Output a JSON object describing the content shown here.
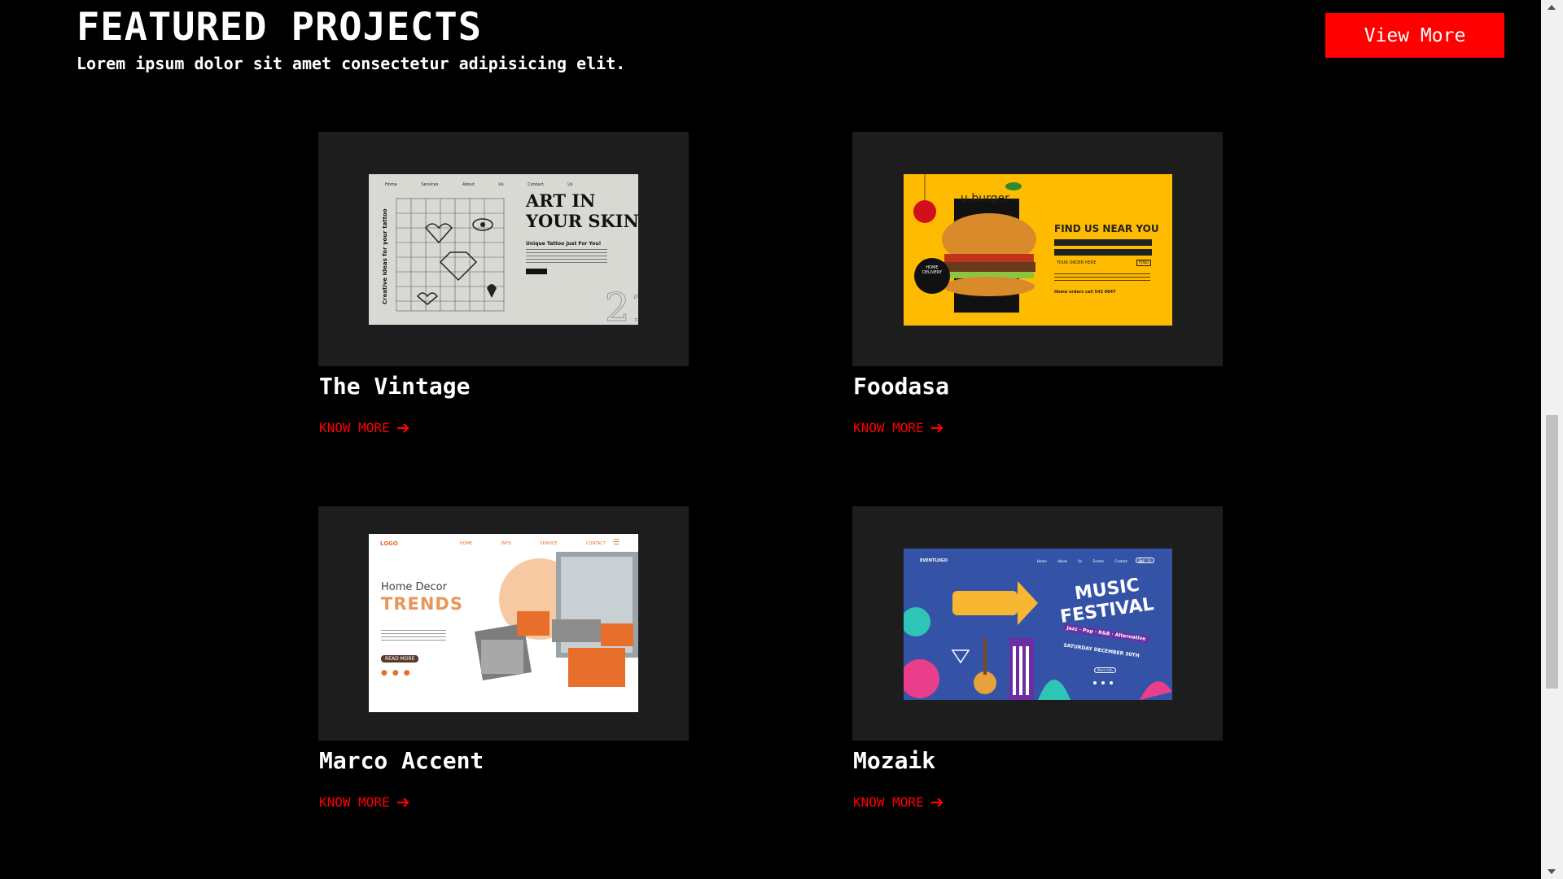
{
  "header": {
    "title": "FEATURED PROJECTS",
    "subtitle": "Lorem ipsum dolor sit amet consectetur adipisicing elit.",
    "view_more_label": "View More"
  },
  "colors": {
    "accent": "#ff0000",
    "background": "#000000",
    "card_bg": "#1d1d1d",
    "text": "#ffffff"
  },
  "projects": [
    {
      "title": "The Vintage",
      "link_label": "KNOW MORE",
      "thumbnail": {
        "headline_1": "ART IN",
        "headline_2": "YOUR SKIN",
        "tagline": "Unique Tattoo Just For You!",
        "side_text": "Creative Ideas for your tattoo",
        "nav": [
          "Home",
          "Services",
          "About Us",
          "Contact Us"
        ]
      }
    },
    {
      "title": "Foodasa",
      "link_label": "KNOW MORE",
      "thumbnail": {
        "brand": "u.burger",
        "headline": "FIND US NEAR YOU",
        "badge": "HOME DELIVERY",
        "order_label": "YOUR ORDER HERE",
        "find_button": "FIND",
        "phone": "Home orders call 543 0847"
      }
    },
    {
      "title": "Marco Accent",
      "link_label": "KNOW MORE",
      "thumbnail": {
        "logo": "LOGO",
        "nav": [
          "HOME",
          "INFO",
          "SERVICE",
          "CONTACT"
        ],
        "headline_1": "Home Decor",
        "headline_2": "TRENDS",
        "cta": "READ MORE"
      }
    },
    {
      "title": "Mozaik",
      "link_label": "KNOW MORE",
      "thumbnail": {
        "logo": "EVENTLOGO",
        "nav": [
          "Home",
          "About Us",
          "Events",
          "Contact Us",
          "Sign Up"
        ],
        "headline_1": "MUSIC",
        "headline_2": "FESTIVAL",
        "genres": "Jazz · Pop · R&B · Alternative",
        "date": "SATURDAY DECEMBER 30TH",
        "cta": "More Info"
      }
    }
  ]
}
